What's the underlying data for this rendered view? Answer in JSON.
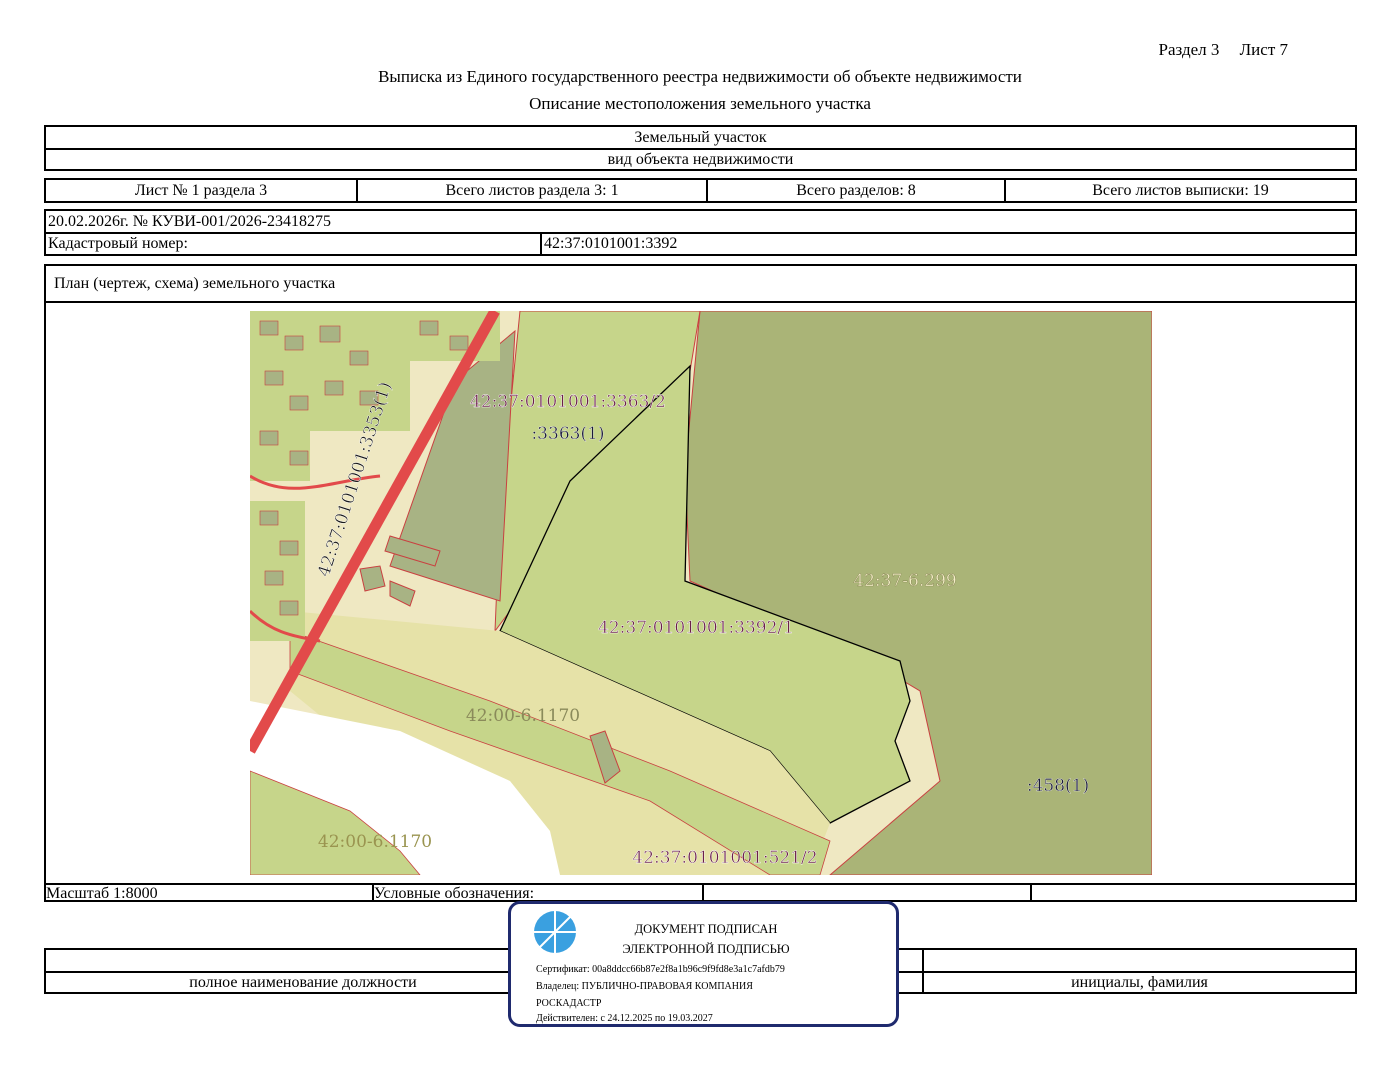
{
  "header": {
    "section": "Раздел 3",
    "sheet": "Лист 7",
    "title": "Выписка из Единого государственного реестра недвижимости об объекте недвижимости",
    "subtitle": "Описание местоположения земельного участка"
  },
  "object": {
    "type": "Земельный участок",
    "caption": "вид объекта недвижимости"
  },
  "sheets": {
    "sheet_no": "Лист № 1 раздела 3",
    "total_section_sheets": "Всего листов раздела 3: 1",
    "total_sections": "Всего разделов: 8",
    "total_extract_sheets": "Всего листов выписки: 19"
  },
  "record": {
    "date_number": "20.02.2026г. № КУВИ-001/2026-23418275",
    "cadastral_label": "Кадастровый номер:",
    "cadastral_value": "42:37:0101001:3392"
  },
  "plan": {
    "title": "План (чертеж, схема) земельного участка",
    "labels": {
      "parcel_3363_2": "42:37:0101001:3363/2",
      "parcel_3363_1": ":3363(1)",
      "road_3353": "42:37:0101001:3353(1)",
      "zone_6299": "42:37-6.299",
      "parcel_3392_1": "42:37:0101001:3392/1",
      "zone_6_1170_a": "42:00-6.1170",
      "zone_6_1170_b": "42:00-6.1170",
      "parcel_458": ":458(1)",
      "parcel_521_2": "42:37:0101001:521/2"
    },
    "colors": {
      "light_bg": "#efe8c2",
      "light_green": "#c6d58a",
      "dark_olive": "#aab477",
      "mid_olive": "#a8b384",
      "road": "#e24a4a",
      "label_purple": "#6b1f4a"
    }
  },
  "footer": {
    "scale": "Масштаб 1:8000",
    "legend": "Условные обозначения:",
    "position_caption": "полное наименование должности",
    "initials_caption": "инициалы, фамилия"
  },
  "stamp": {
    "line1": "ДОКУМЕНТ ПОДПИСАН",
    "line2": "ЭЛЕКТРОННОЙ ПОДПИСЬЮ",
    "certificate": "Сертификат: 00a8ddcc66b87e2f8a1b96c9f9fd8e3a1c7afdb79",
    "owner_line1": "Владелец: ПУБЛИЧНО-ПРАВОВАЯ КОМПАНИЯ",
    "owner_line2": "РОСКАДАСТР",
    "valid": "Действителен: с 24.12.2025 по 19.03.2027"
  }
}
